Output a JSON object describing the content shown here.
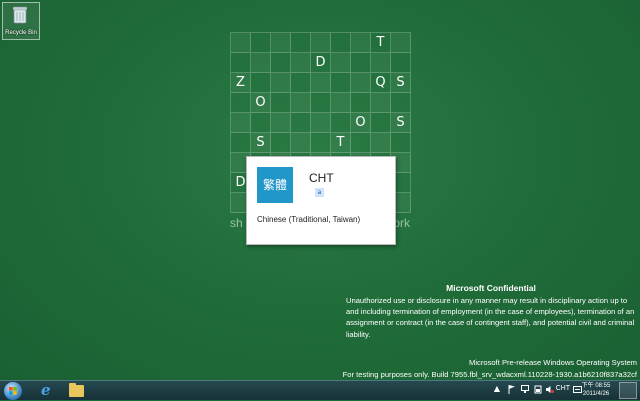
{
  "desktop": {
    "recycle_bin_label": "Recycle Bin",
    "grid": [
      [
        "",
        "",
        "",
        "",
        "",
        "",
        "",
        "T",
        ""
      ],
      [
        "",
        "",
        "",
        "",
        "D",
        "",
        "",
        "",
        ""
      ],
      [
        "Z",
        "",
        "",
        "",
        "",
        "",
        "",
        "Q",
        "S"
      ],
      [
        "",
        "O",
        "",
        "",
        "",
        "",
        "",
        "",
        ""
      ],
      [
        "",
        "",
        "",
        "",
        "",
        "",
        "O",
        "",
        "S"
      ],
      [
        "",
        "S",
        "",
        "",
        "",
        "T",
        "",
        "",
        ""
      ],
      [
        "",
        "",
        "",
        "",
        "",
        "",
        "",
        "",
        ""
      ],
      [
        "D",
        "",
        "",
        "",
        "",
        "",
        "",
        "",
        ""
      ],
      [
        "",
        "",
        "",
        "",
        "",
        "",
        "",
        "",
        ""
      ]
    ],
    "tagline_left": "sh",
    "tagline_right": "ork"
  },
  "ime_popup": {
    "tile_text": "繁體",
    "code": "CHT",
    "mini_badge": "a",
    "language": "Chinese (Traditional, Taiwan)"
  },
  "watermark": {
    "title": "Microsoft Confidential",
    "body": "Unauthorized use or disclosure in any manner may result in disciplinary action up to and including termination of employment (in the case of employees), termination of an assignment or contract (in the case of contingent staff), and potential civil and criminal liability.",
    "os_line": "Microsoft Pre-release Windows Operating System",
    "build_line": "For testing purposes only. Build 7955.fbl_srv_wdacxml.110228-1930.a1b6210f837a32cf"
  },
  "taskbar": {
    "input_indicator": "CHT",
    "time": "下午 08:55",
    "date": "2011/4/26",
    "tray_up_arrow": "▲"
  },
  "colors": {
    "desktop_green": "#1f6b38",
    "ime_tile_blue": "#2196c9"
  }
}
